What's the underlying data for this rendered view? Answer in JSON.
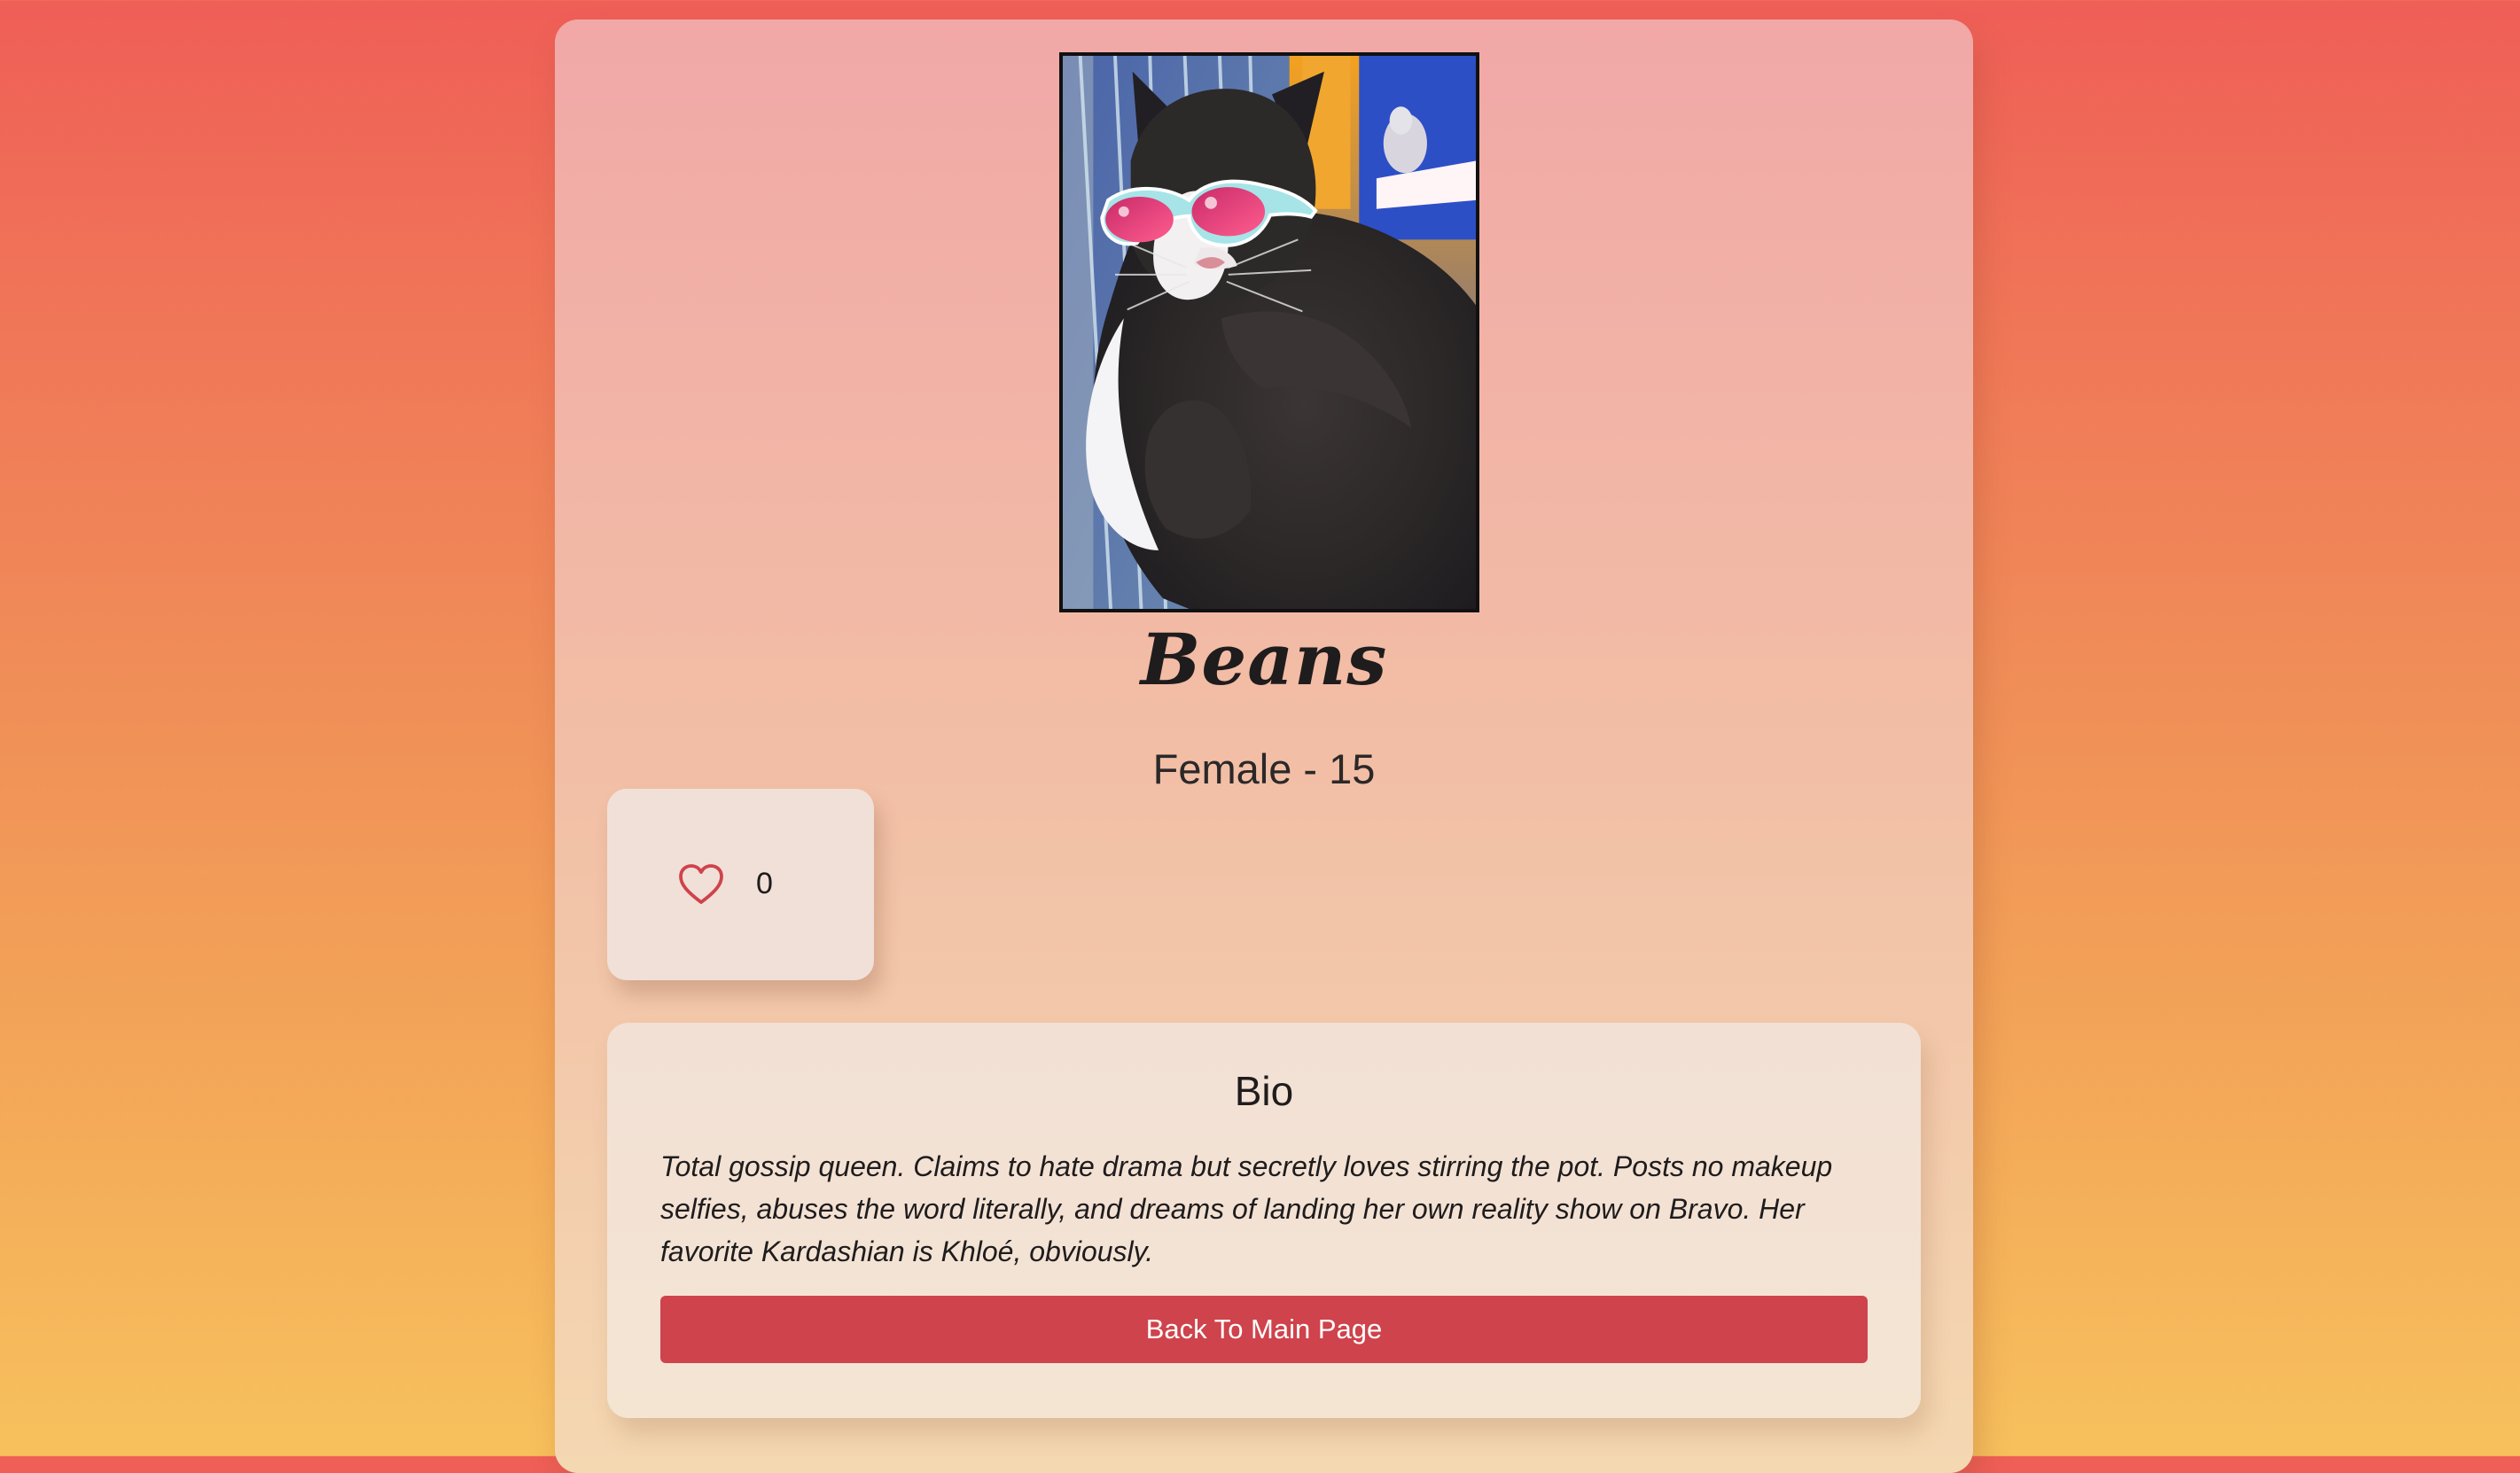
{
  "profile": {
    "name": "Beans",
    "meta": "Female - 15",
    "photo_icon": "cat-photo"
  },
  "likes": {
    "icon": "heart-icon",
    "count": "0",
    "accent_color": "#cf434c"
  },
  "bio": {
    "title": "Bio",
    "text": "Total gossip queen. Claims to hate drama but secretly loves stirring the pot. Posts no makeup selfies, abuses the word literally, and dreams of landing her own reality show on Bravo. Her favorite Kardashian is Khloé, obviously.",
    "button_label": "Back To Main Page"
  },
  "colors": {
    "page_gradient_top": "#ef5e57",
    "page_gradient_bottom": "#f7c15d",
    "button": "#cf434c"
  }
}
